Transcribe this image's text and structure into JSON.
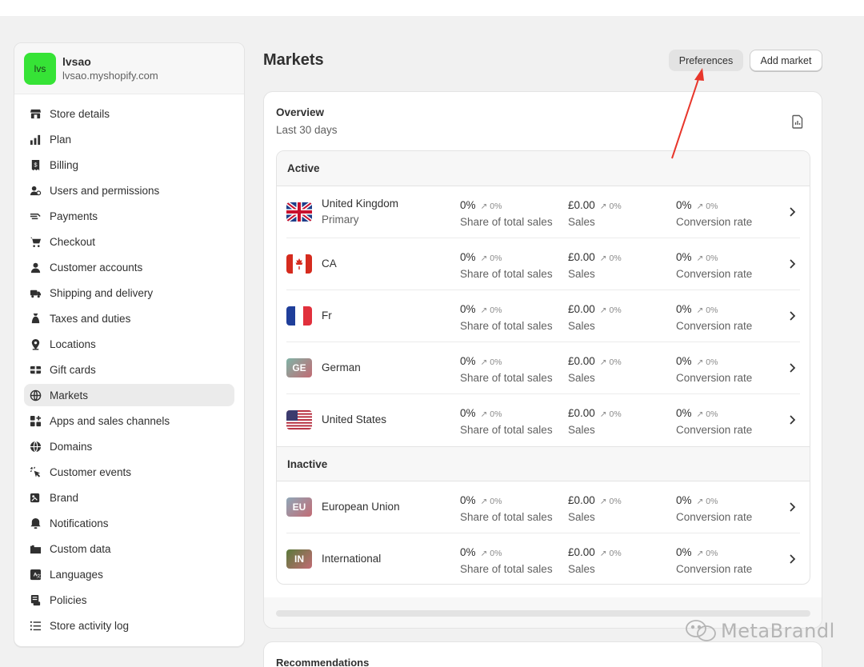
{
  "store": {
    "avatar_text": "lvs",
    "name": "lvsao",
    "domain": "lvsao.myshopify.com"
  },
  "nav": [
    {
      "label": "Store details",
      "icon": "store-icon"
    },
    {
      "label": "Plan",
      "icon": "plan-icon"
    },
    {
      "label": "Billing",
      "icon": "receipt-icon"
    },
    {
      "label": "Users and permissions",
      "icon": "users-icon"
    },
    {
      "label": "Payments",
      "icon": "payments-icon"
    },
    {
      "label": "Checkout",
      "icon": "cart-icon"
    },
    {
      "label": "Customer accounts",
      "icon": "person-icon"
    },
    {
      "label": "Shipping and delivery",
      "icon": "truck-icon"
    },
    {
      "label": "Taxes and duties",
      "icon": "tax-bag-icon"
    },
    {
      "label": "Locations",
      "icon": "location-pin-icon"
    },
    {
      "label": "Gift cards",
      "icon": "gift-card-icon"
    },
    {
      "label": "Markets",
      "icon": "globe-icon",
      "active": true
    },
    {
      "label": "Apps and sales channels",
      "icon": "apps-icon"
    },
    {
      "label": "Domains",
      "icon": "domain-globe-icon"
    },
    {
      "label": "Customer events",
      "icon": "cursor-click-icon"
    },
    {
      "label": "Brand",
      "icon": "brand-icon"
    },
    {
      "label": "Notifications",
      "icon": "bell-icon"
    },
    {
      "label": "Custom data",
      "icon": "folder-icon"
    },
    {
      "label": "Languages",
      "icon": "language-icon"
    },
    {
      "label": "Policies",
      "icon": "policy-icon"
    },
    {
      "label": "Store activity log",
      "icon": "list-icon"
    }
  ],
  "header": {
    "title": "Markets",
    "preferences_label": "Preferences",
    "add_market_label": "Add market"
  },
  "overview": {
    "title": "Overview",
    "subtitle": "Last 30 days"
  },
  "sections": {
    "active_label": "Active",
    "inactive_label": "Inactive"
  },
  "metric_labels": {
    "share": "Share of total sales",
    "sales": "Sales",
    "conversion": "Conversion rate"
  },
  "active_markets": [
    {
      "name": "United Kingdom",
      "sub": "Primary",
      "flag": "uk",
      "share": "0%",
      "share_delta": "↗ 0%",
      "sales": "£0.00",
      "sales_delta": "↗ 0%",
      "conv": "0%",
      "conv_delta": "↗ 0%"
    },
    {
      "name": "CA",
      "flag": "ca",
      "share": "0%",
      "share_delta": "↗ 0%",
      "sales": "£0.00",
      "sales_delta": "↗ 0%",
      "conv": "0%",
      "conv_delta": "↗ 0%"
    },
    {
      "name": "Fr",
      "flag": "fr",
      "share": "0%",
      "share_delta": "↗ 0%",
      "sales": "£0.00",
      "sales_delta": "↗ 0%",
      "conv": "0%",
      "conv_delta": "↗ 0%"
    },
    {
      "name": "German",
      "badge": "GE",
      "badge_color": "#7fb3a6",
      "share": "0%",
      "share_delta": "↗ 0%",
      "sales": "£0.00",
      "sales_delta": "↗ 0%",
      "conv": "0%",
      "conv_delta": "↗ 0%"
    },
    {
      "name": "United States",
      "flag": "us",
      "share": "0%",
      "share_delta": "↗ 0%",
      "sales": "£0.00",
      "sales_delta": "↗ 0%",
      "conv": "0%",
      "conv_delta": "↗ 0%"
    }
  ],
  "inactive_markets": [
    {
      "name": "European Union",
      "badge": "EU",
      "badge_color": "#8fa7b8",
      "share": "0%",
      "share_delta": "↗ 0%",
      "sales": "£0.00",
      "sales_delta": "↗ 0%",
      "conv": "0%",
      "conv_delta": "↗ 0%"
    },
    {
      "name": "International",
      "badge": "IN",
      "badge_color": "#5a7a3a",
      "share": "0%",
      "share_delta": "↗ 0%",
      "sales": "£0.00",
      "sales_delta": "↗ 0%",
      "conv": "0%",
      "conv_delta": "↗ 0%"
    }
  ],
  "recommendations": {
    "title": "Recommendations"
  },
  "watermark": {
    "text": "MetaBrandl"
  },
  "colors": {
    "accent_arrow": "#e8362b",
    "avatar_bg": "#36e336",
    "active_nav_bg": "#ebebeb"
  }
}
